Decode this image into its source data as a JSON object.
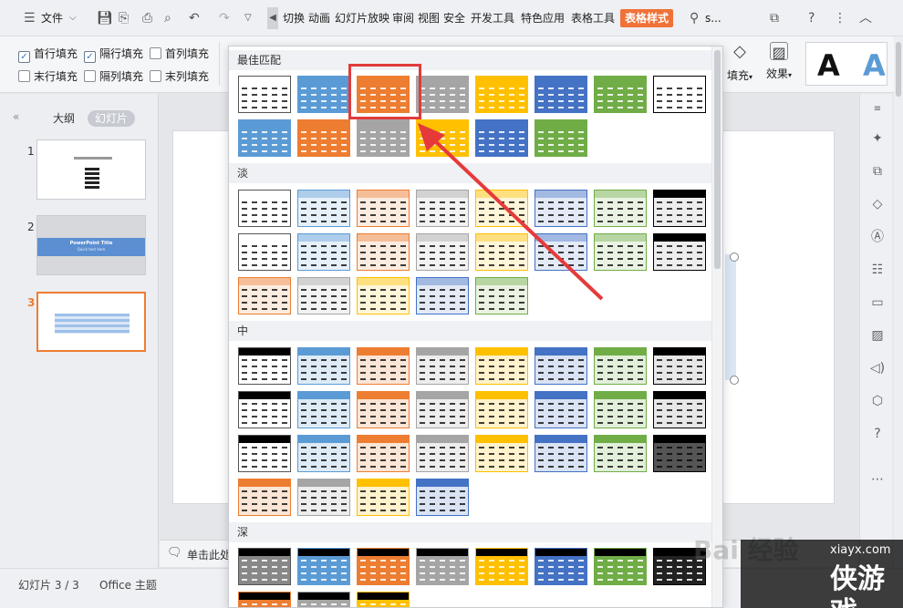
{
  "menubar": {
    "file": "文件",
    "tabs": [
      "切换",
      "动画",
      "幻灯片放映",
      "审阅",
      "视图",
      "安全",
      "开发工具",
      "特色应用",
      "表格工具",
      "表格样式"
    ],
    "active_tab": "表格样式",
    "search": "s..."
  },
  "ribbon": {
    "options": [
      {
        "label": "首行填充",
        "checked": true
      },
      {
        "label": "隔行填充",
        "checked": true
      },
      {
        "label": "首列填充",
        "checked": false
      },
      {
        "label": "末行填充",
        "checked": false
      },
      {
        "label": "隔列填充",
        "checked": false
      },
      {
        "label": "末列填充",
        "checked": false
      }
    ],
    "fill_label": "填充",
    "effect_label": "效果",
    "big_a": "A"
  },
  "left": {
    "tab_outline": "大纲",
    "tab_slides": "幻灯片",
    "thumbs": [
      {
        "num": "1"
      },
      {
        "num": "2",
        "title": "PowerPoint Title",
        "subtitle": "Quick text here"
      },
      {
        "num": "3"
      }
    ]
  },
  "notes": {
    "placeholder": "单击此处"
  },
  "status": {
    "slide": "幻灯片 3 / 3",
    "theme": "Office 主题"
  },
  "gallery": {
    "sections": [
      "最佳匹配",
      "淡",
      "中",
      "深"
    ],
    "accent_colors": {
      "white": "#ffffff",
      "blue": "#5b9bd5",
      "orange": "#ed7d31",
      "gray": "#a5a5a5",
      "gold": "#ffc000",
      "navy": "#4472c4",
      "green": "#70ad47",
      "black": "#000000"
    }
  },
  "watermark": {
    "site": "xiayx.com",
    "brand": "侠游戏",
    "baidu": "Bai 经验"
  }
}
